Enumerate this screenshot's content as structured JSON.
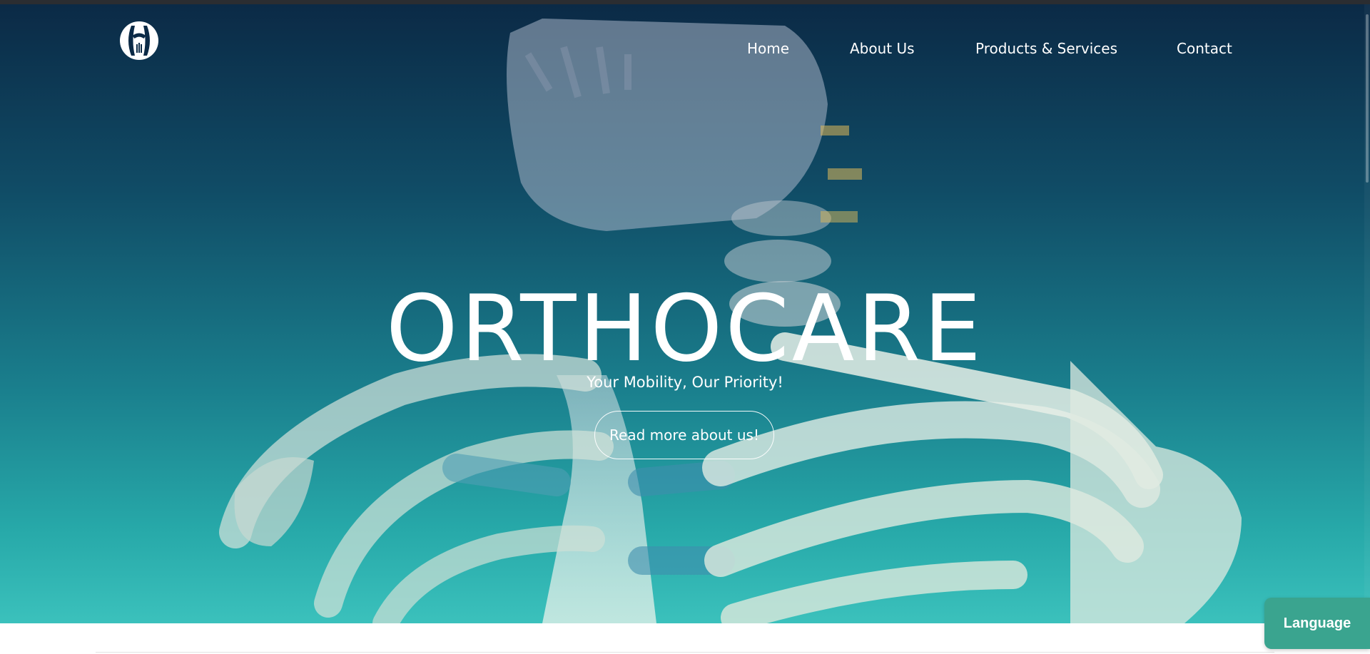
{
  "nav": {
    "logo_icon": "orthocare-logo-icon",
    "links": [
      {
        "label": "Home"
      },
      {
        "label": "About Us"
      },
      {
        "label": "Products & Services"
      },
      {
        "label": "Contact"
      }
    ]
  },
  "hero": {
    "title": "ORTHOCARE",
    "subtitle": "Your Mobility, Our Priority!",
    "cta_label": "Read more about us!"
  },
  "language_button": {
    "label": "Language"
  },
  "colors": {
    "hero_top": "#0b2a46",
    "hero_bottom": "#3bc1bc",
    "language_button": "#3aa48f",
    "text": "#ffffff"
  }
}
